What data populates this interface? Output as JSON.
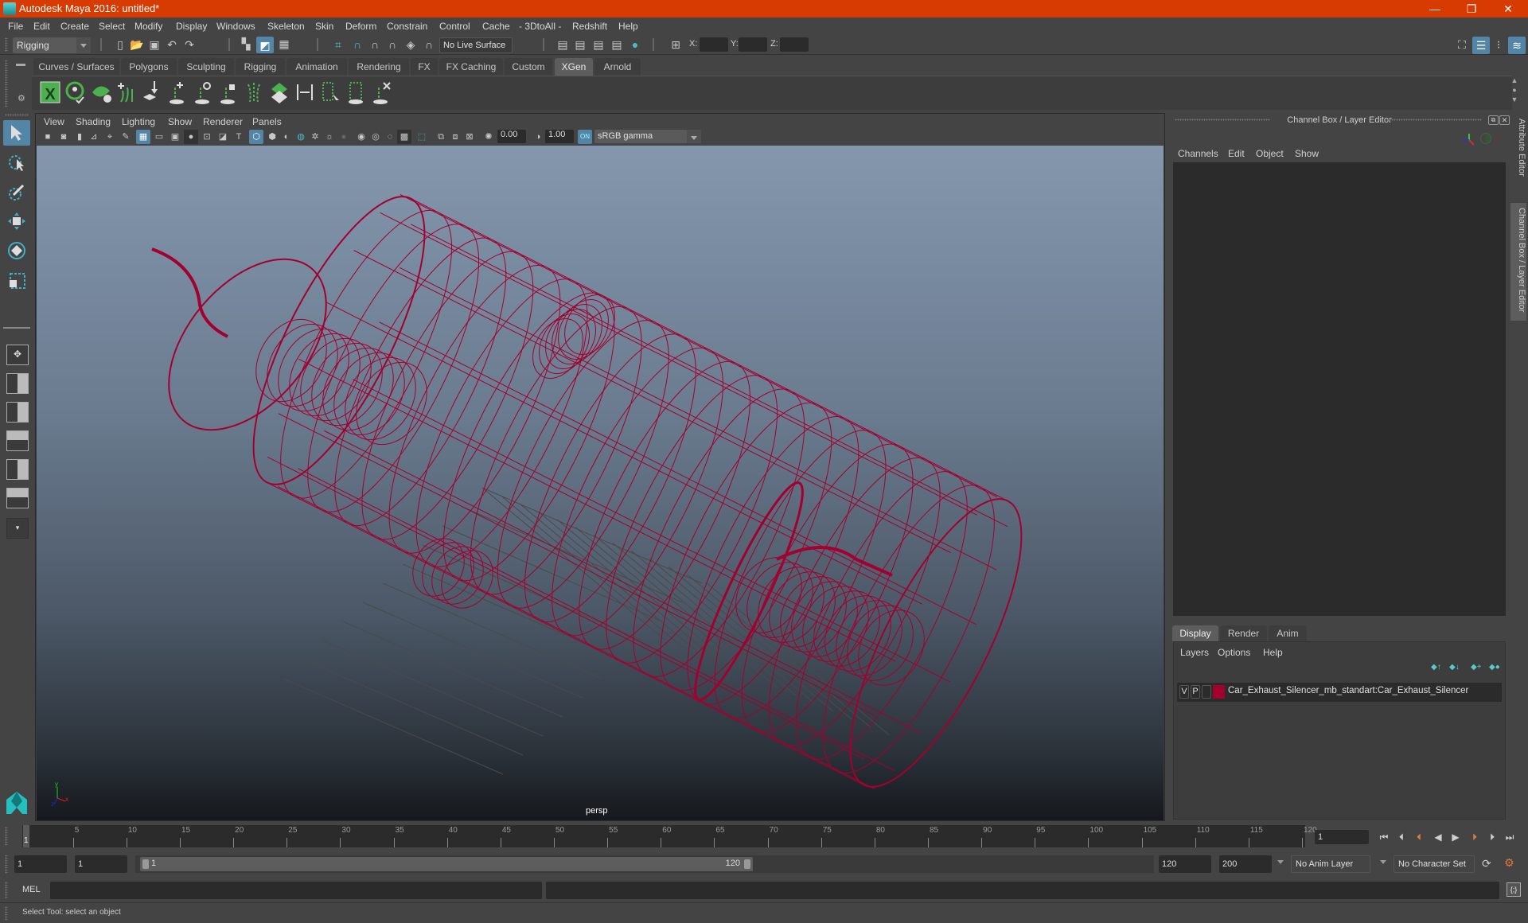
{
  "window": {
    "title": "Autodesk Maya 2016: untitled*",
    "controls": {
      "minimize": "—",
      "maximize": "❐",
      "close": "✕"
    }
  },
  "menubar": [
    "File",
    "Edit",
    "Create",
    "Select",
    "Modify",
    "Display",
    "Windows",
    "Skeleton",
    "Skin",
    "Deform",
    "Constrain",
    "Control",
    "Cache",
    "- 3DtoAll -",
    "Redshift",
    "Help"
  ],
  "statusline": {
    "menuset": "Rigging",
    "live_surface": "No Live Surface",
    "x_label": "X:",
    "y_label": "Y:",
    "z_label": "Z:",
    "x_value": "",
    "y_value": "",
    "z_value": ""
  },
  "shelf": {
    "tabs": [
      "Curves / Surfaces",
      "Polygons",
      "Sculpting",
      "Rigging",
      "Animation",
      "Rendering",
      "FX",
      "FX Caching",
      "Custom",
      "XGen",
      "Arnold"
    ],
    "active_tab": "XGen",
    "icons": [
      "xgen-window-icon",
      "xgen-preview-icon",
      "xgen-clear-icon",
      "xgen-add-guide-icon",
      "xgen-place-guide-icon",
      "xgen-add-guide-single-icon",
      "xgen-select-guide-icon",
      "xgen-lock-guide-icon",
      "xgen-bend-guide-icon",
      "xgen-sculpt-icon",
      "xgen-length-icon",
      "xgen-select-tool-icon",
      "xgen-rebuild-icon",
      "xgen-delete-icon"
    ]
  },
  "viewport": {
    "menu": [
      "View",
      "Shading",
      "Lighting",
      "Show",
      "Renderer",
      "Panels"
    ],
    "exposure": "0.00",
    "gamma": "1.00",
    "color_space": "sRGB gamma",
    "camera": "persp",
    "wire_color": "#a30030",
    "axis": {
      "x": "x",
      "y": "y",
      "z": "z"
    }
  },
  "channelbox": {
    "title": "Channel Box / Layer Editor",
    "menu": [
      "Channels",
      "Edit",
      "Object",
      "Show"
    ],
    "layer_tabs": [
      "Display",
      "Render",
      "Anim"
    ],
    "active_layer_tab": "Display",
    "layer_menu": [
      "Layers",
      "Options",
      "Help"
    ],
    "layers": [
      {
        "v": "V",
        "p": "P",
        "color": "#a30030",
        "name": "Car_Exhaust_Silencer_mb_standart:Car_Exhaust_Silencer"
      }
    ]
  },
  "side_tabs": [
    "Attribute Editor",
    "Channel Box / Layer Editor"
  ],
  "timeline": {
    "ticks": [
      5,
      10,
      15,
      20,
      25,
      30,
      35,
      40,
      45,
      50,
      55,
      60,
      65,
      70,
      75,
      80,
      85,
      90,
      95,
      100,
      105,
      110,
      115,
      120
    ],
    "range": [
      1,
      120
    ],
    "current_frame": "1",
    "current_frame_field": "1"
  },
  "range": {
    "start": "1",
    "playback_start": "1",
    "slider_start": "1",
    "slider_end": "120",
    "playback_end": "120",
    "end": "200",
    "anim_layer": "No Anim Layer",
    "character_set": "No Character Set"
  },
  "cmdline": {
    "label": "MEL",
    "input": "",
    "result": ""
  },
  "helpline": {
    "text": "Select Tool: select an object"
  }
}
